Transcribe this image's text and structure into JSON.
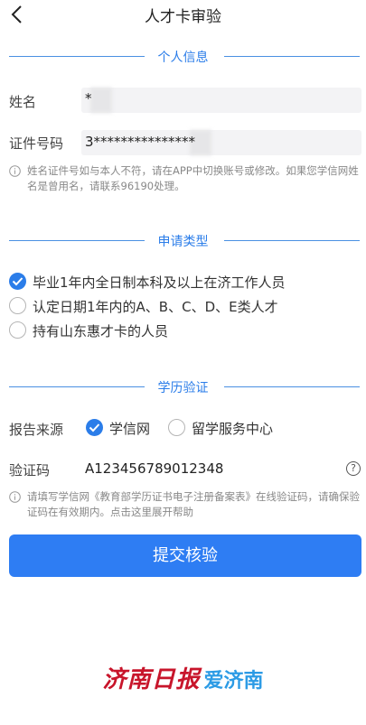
{
  "header": {
    "title": "人才卡审验",
    "back_icon": "chevron-left-icon"
  },
  "personal": {
    "section_title": "个人信息",
    "name_label": "姓名",
    "name_value": "*",
    "id_label": "证件号码",
    "id_value": "3***************",
    "note": "姓名证件号如与本人不符，请在APP中切换账号或修改。如果您学信网姓名是曾用名，请联系96190处理。"
  },
  "apply_type": {
    "section_title": "申请类型",
    "options": [
      {
        "label": "毕业1年内全日制本科及以上在济工作人员",
        "selected": true
      },
      {
        "label": "认定日期1年内的A、B、C、D、E类人才",
        "selected": false
      },
      {
        "label": "持有山东惠才卡的人员",
        "selected": false
      }
    ]
  },
  "education": {
    "section_title": "学历验证",
    "source_label": "报告来源",
    "sources": [
      {
        "label": "学信网",
        "selected": true
      },
      {
        "label": "留学服务中心",
        "selected": false
      }
    ],
    "code_label": "验证码",
    "code_value": "A123456789012348",
    "help_icon": "?",
    "note": "请填写学信网《教育部学历证书电子注册备案表》在线验证码，请确保验证码在有效期内。点击这里展开帮助"
  },
  "submit_label": "提交核验",
  "watermark": {
    "paper": "济南日报",
    "app": "爱济南"
  },
  "colors": {
    "accent": "#2b7de9",
    "button": "#2e7df3",
    "watermark_red": "#c8152b",
    "watermark_blue": "#2c9be5"
  }
}
